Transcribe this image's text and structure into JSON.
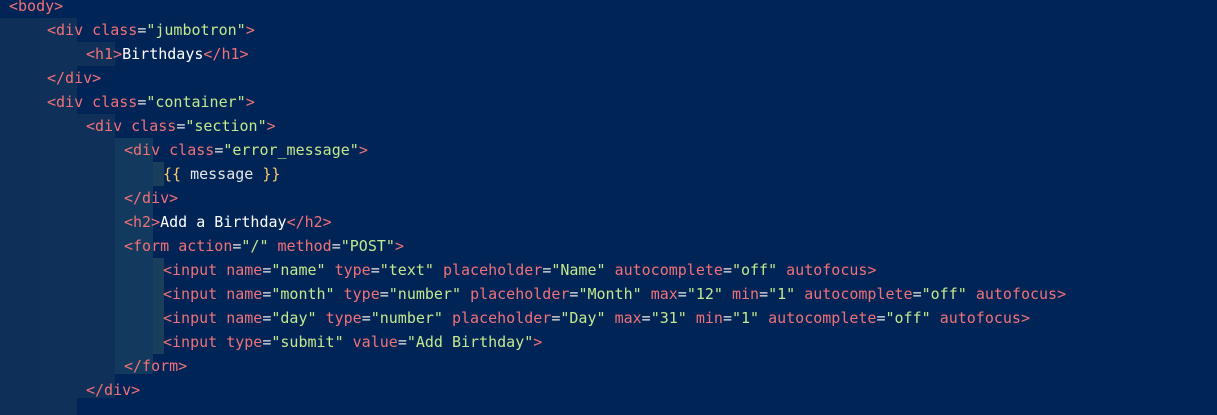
{
  "code": {
    "l1": {
      "open": "<body>"
    },
    "l2": {
      "open": "<div",
      "attr": "class",
      "val": "\"jumbotron\"",
      "close": ">"
    },
    "l3": {
      "open": "<h1>",
      "text": "Birthdays",
      "close": "</h1>"
    },
    "l4": {
      "close": "</div>"
    },
    "l5": {
      "open": "<div",
      "attr": "class",
      "val": "\"container\"",
      "close": ">"
    },
    "l6": {
      "open": "<div",
      "attr": "class",
      "val": "\"section\"",
      "close": ">"
    },
    "l7": {
      "open": "<div",
      "attr": "class",
      "val": "\"error_message\"",
      "close": ">"
    },
    "l8": {
      "b1": "{{",
      "text": " message ",
      "b2": "}}"
    },
    "l9": {
      "close": "</div>"
    },
    "l10": {
      "open": "<h2>",
      "text": "Add a Birthday",
      "close": "</h2>"
    },
    "l11": {
      "open": "<form",
      "a1": "action",
      "v1": "\"/\"",
      "a2": "method",
      "v2": "\"POST\"",
      "close": ">"
    },
    "l12": {
      "open": "<input",
      "a1": "name",
      "v1": "\"name\"",
      "a2": "type",
      "v2": "\"text\"",
      "a3": "placeholder",
      "v3": "\"Name\"",
      "a4": "autocomplete",
      "v4": "\"off\"",
      "a5": "autofocus",
      "close": ">"
    },
    "l13": {
      "open": "<input",
      "a1": "name",
      "v1": "\"month\"",
      "a2": "type",
      "v2": "\"number\"",
      "a3": "placeholder",
      "v3": "\"Month\"",
      "a4": "max",
      "v4": "\"12\"",
      "a5": "min",
      "v5": "\"1\"",
      "a6": "autocomplete",
      "v6": "\"off\"",
      "a7": "autofocus",
      "close": ">"
    },
    "l14": {
      "open": "<input",
      "a1": "name",
      "v1": "\"day\"",
      "a2": "type",
      "v2": "\"number\"",
      "a3": "placeholder",
      "v3": "\"Day\"",
      "a4": "max",
      "v4": "\"31\"",
      "a5": "min",
      "v5": "\"1\"",
      "a6": "autocomplete",
      "v6": "\"off\"",
      "a7": "autofocus",
      "close": ">"
    },
    "l15": {
      "open": "<input",
      "a1": "type",
      "v1": "\"submit\"",
      "a2": "value",
      "v2": "\"Add Birthday\"",
      "close": ">"
    },
    "l16": {
      "close": "</form>"
    },
    "l17": {
      "close": "</div>"
    }
  },
  "colors": {
    "background": "#012456",
    "tag": "#f07178",
    "string": "#c3e88d",
    "text": "#ffffff",
    "template_brace": "#ffcb6b"
  }
}
